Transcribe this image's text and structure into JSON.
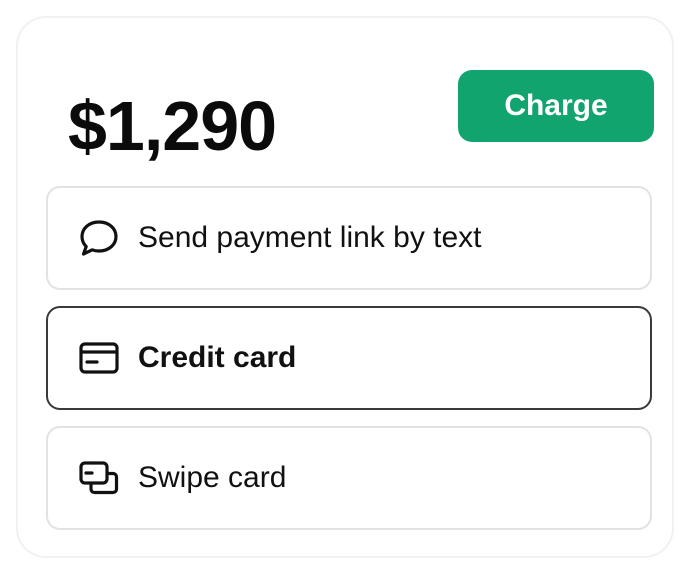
{
  "payment": {
    "amount": "$1,290",
    "charge_label": "Charge",
    "accent_color": "#12a46f"
  },
  "options": [
    {
      "label": "Send payment link by text",
      "icon": "chat-bubble-icon",
      "selected": false
    },
    {
      "label": "Credit card",
      "icon": "credit-card-icon",
      "selected": true
    },
    {
      "label": "Swipe card",
      "icon": "swipe-cards-icon",
      "selected": false
    }
  ]
}
